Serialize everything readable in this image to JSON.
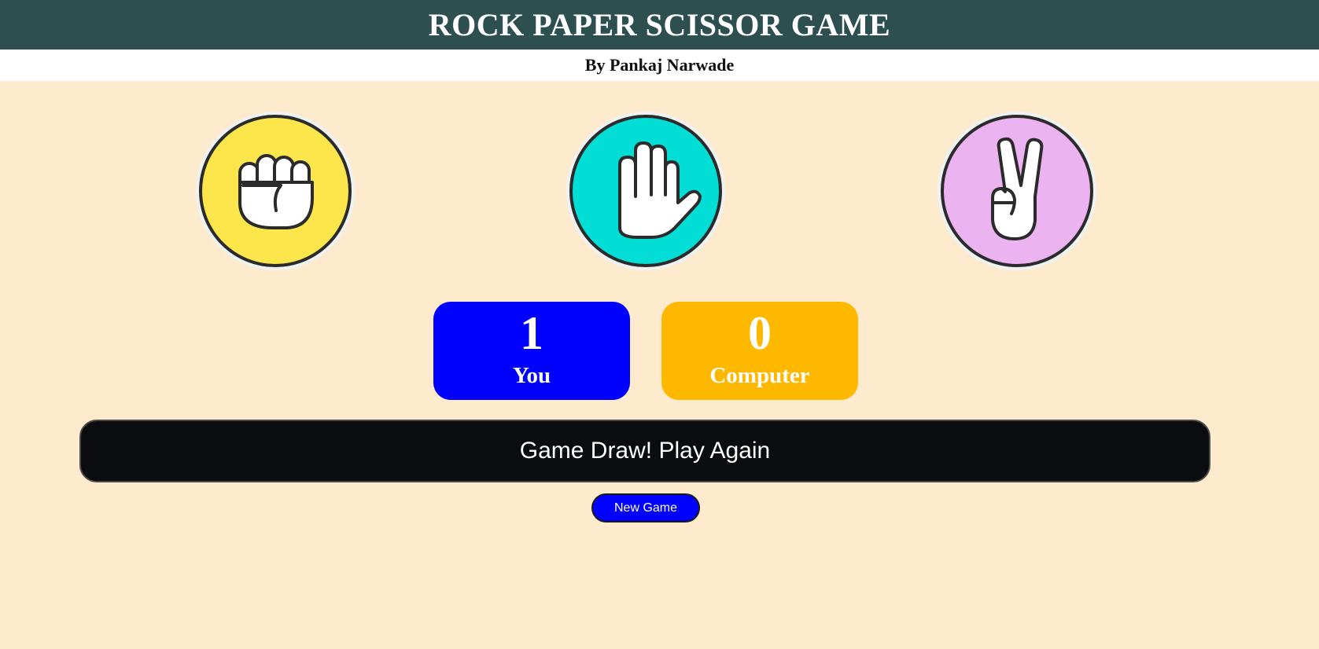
{
  "header": {
    "title": "ROCK PAPER SCISSOR GAME",
    "author": "By Pankaj Narwade",
    "bg_color": "#2e4f4f"
  },
  "choices": [
    {
      "name": "rock",
      "icon": "fist-icon",
      "color": "#fde64b"
    },
    {
      "name": "paper",
      "icon": "open-hand-icon",
      "color": "#02ddd5"
    },
    {
      "name": "scissors",
      "icon": "victory-hand-icon",
      "color": "#ebb3f0"
    }
  ],
  "scores": {
    "you": {
      "value": "1",
      "label": "You",
      "color": "#0000ff"
    },
    "computer": {
      "value": "0",
      "label": "Computer",
      "color": "#ffb800"
    }
  },
  "message": "Game Draw! Play Again",
  "new_game_label": "New Game",
  "page_bg": "#feeacd"
}
